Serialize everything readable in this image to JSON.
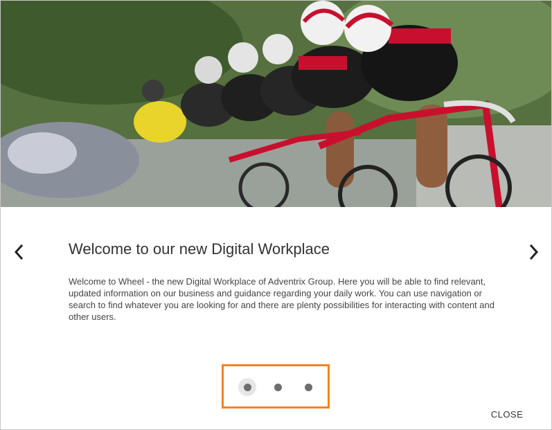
{
  "dialog": {
    "hero_image": "cyclists-peloton-photo",
    "prev_icon": "chevron-left-icon",
    "next_icon": "chevron-right-icon",
    "title": "Welcome to our new Digital Workplace",
    "body": "Welcome to Wheel - the new Digital Workplace of Adventrix Group. Here you will be able to find relevant, updated information on our business and guidance regarding your daily work. You can use navigation or search to find whatever you are looking for and there are plenty possibilities for interacting with content and other users.",
    "pagination": {
      "count": 3,
      "active_index": 0
    },
    "close_label": "CLOSE",
    "highlight_color": "#f58220"
  }
}
